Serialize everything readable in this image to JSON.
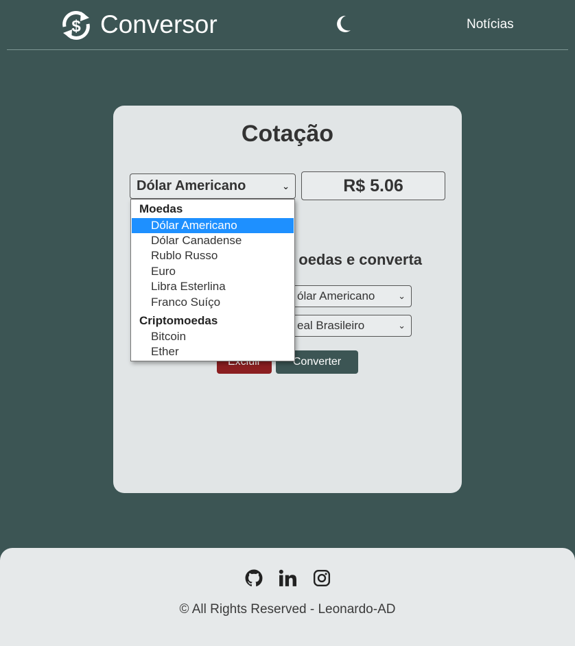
{
  "header": {
    "brand": "Conversor",
    "nav_news": "Notícias",
    "logo_icon": "currency-exchange-icon",
    "theme_icon": "moon-icon"
  },
  "card": {
    "title": "Cotação",
    "quote_select_value": "Dólar Americano",
    "quote_value": "R$ 5.06",
    "subtitle_visible": "oedas e converta",
    "from_select_value": "ólar Americano",
    "to_select_value": "eal Brasileiro",
    "delete_label": "Excluir",
    "convert_label": "Converter"
  },
  "dropdown": {
    "groups": [
      {
        "label": "Moedas",
        "options": [
          "Dólar Americano",
          "Dólar Canadense",
          "Rublo Russo",
          "Euro",
          "Libra Esterlina",
          "Franco Suíço"
        ]
      },
      {
        "label": "Criptomoedas",
        "options": [
          "Bitcoin",
          "Ether"
        ]
      }
    ],
    "selected": "Dólar Americano"
  },
  "footer": {
    "copyright": "© All Rights Reserved - Leonardo-AD",
    "social_icons": [
      "github-icon",
      "linkedin-icon",
      "instagram-icon"
    ]
  },
  "colors": {
    "background": "#3c5554",
    "card": "#e1e5e6",
    "footer": "#e6e9ea",
    "delete_button": "#8b1f21",
    "convert_button": "#3c5554",
    "selection": "#1e90ff"
  }
}
